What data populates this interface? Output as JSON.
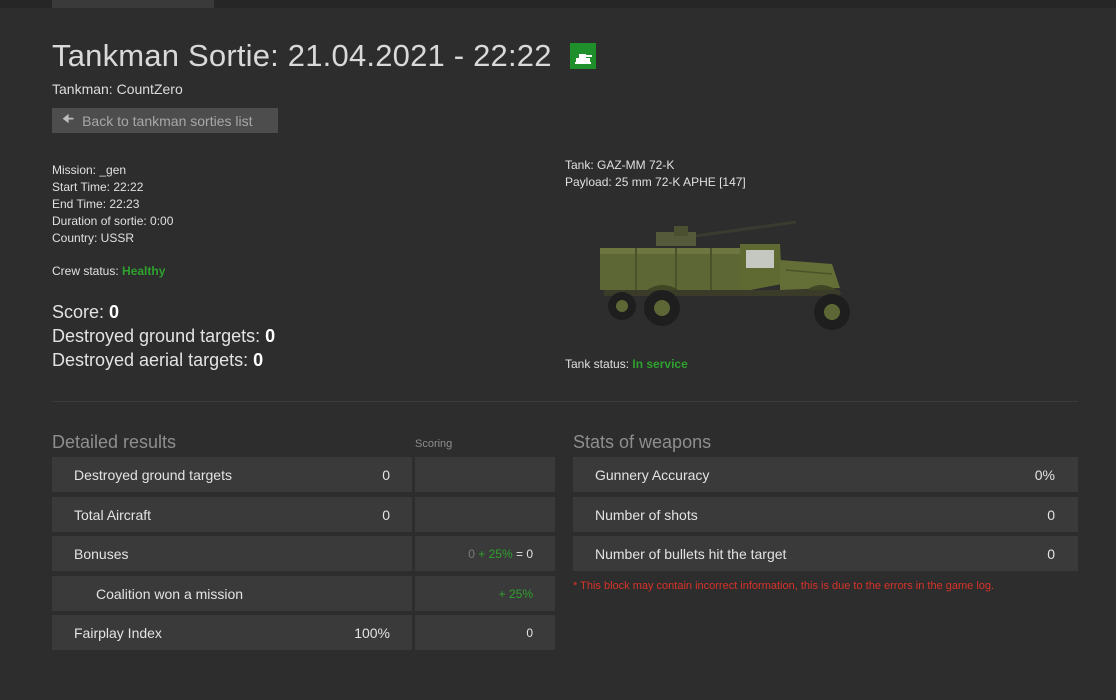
{
  "header": {
    "title": "Tankman Sortie: 21.04.2021 - 22:22",
    "tankman": "Tankman: CountZero",
    "back_label": "Back to tankman sorties list"
  },
  "mission_info": {
    "mission": "Mission: _gen",
    "start": "Start Time: 22:22",
    "end": "End Time: 22:23",
    "duration": "Duration of sortie: 0:00",
    "country": "Country: USSR"
  },
  "crew": {
    "label": "Crew status:",
    "value": "Healthy"
  },
  "scores": {
    "score_label": "Score:",
    "score_value": "0",
    "ground_label": "Destroyed ground targets:",
    "ground_value": "0",
    "aerial_label": "Destroyed aerial targets:",
    "aerial_value": "0"
  },
  "tank": {
    "name": "Tank: GAZ-MM 72-K",
    "payload": "Payload: 25 mm 72-K APHE [147]",
    "status_label": "Tank status:",
    "status_value": "In service"
  },
  "detailed": {
    "title": "Detailed results",
    "scoring_label": "Scoring",
    "rows": [
      {
        "label": "Destroyed ground targets",
        "value": "0",
        "score": ""
      },
      {
        "label": "Total Aircraft",
        "value": "0",
        "score": ""
      },
      {
        "label": "Bonuses",
        "value": "",
        "score_a": "0",
        "score_b": "+ 25%",
        "score_c": "= 0"
      },
      {
        "label": "Coalition won a mission",
        "value": "",
        "score": "+ 25%"
      },
      {
        "label": "Fairplay Index",
        "value": "100%",
        "score": "0"
      }
    ]
  },
  "weapons": {
    "title": "Stats of weapons",
    "rows": [
      {
        "label": "Gunnery Accuracy",
        "value": "0%"
      },
      {
        "label": "Number of shots",
        "value": "0"
      },
      {
        "label": "Number of bullets hit the target",
        "value": "0"
      }
    ],
    "note": "* This block may contain incorrect information, this is due to the errors in the game log."
  },
  "colors": {
    "background": "#2d2d2d",
    "cell": "#3a3a3a",
    "accent_green": "#2ea12e",
    "warning_red": "#d6332a",
    "flag_green": "#1f8f2c"
  },
  "icons": {
    "flag": "tank-flag-icon",
    "back": "arrow-left-icon"
  }
}
